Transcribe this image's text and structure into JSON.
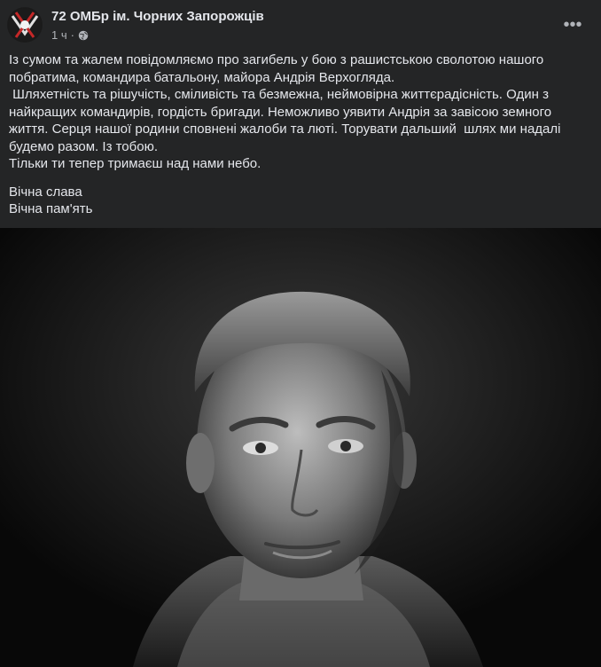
{
  "post": {
    "page_name": "72 ОМБр ім. Чорних Запорожців",
    "time": "1 ч",
    "separator": "·",
    "paragraphs": [
      "Із сумом та жалем повідомляємо про загибель у бою з рашистською сволотою нашого побратима, командира батальону, майора Андрія Верхогляда.",
      " Шляхетність та рішучість, сміливість та безмежна, неймовірна життєрадісність. Один з найкращих командирів, гордість бригади. Неможливо уявити Андрія за завісою земного життя. Серця нашої родини сповнені жалоби та люті. Торувати дальший  шлях ми надалі будемо разом. Із тобою.",
      "Тільки ти тепер тримаєш над нами небо."
    ],
    "closing": [
      "Вічна слава",
      "Вічна пам'ять"
    ]
  },
  "icons": {
    "more": "more-horizontal-icon",
    "privacy": "globe-icon"
  },
  "colors": {
    "background": "#242526",
    "text_primary": "#e4e6eb",
    "text_secondary": "#b0b3b8"
  }
}
